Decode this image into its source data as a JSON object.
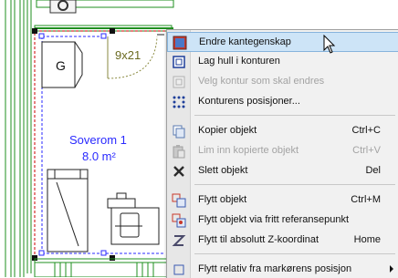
{
  "floorplan": {
    "room_name": "Soverom 1",
    "room_area": "8.0 m²",
    "box_g_label": "G",
    "door_label": "9x21"
  },
  "context_menu": {
    "items": [
      {
        "label": "Endre kantegenskap",
        "shortcut": "",
        "enabled": true,
        "highlighted": true,
        "icon": "edge-properties-icon"
      },
      {
        "label": "Lag hull i konturen",
        "shortcut": "",
        "enabled": true,
        "icon": "make-hole-icon"
      },
      {
        "label": "Velg kontur som skal endres",
        "shortcut": "",
        "enabled": false,
        "icon": "select-contour-icon"
      },
      {
        "label": "Konturens posisjoner...",
        "shortcut": "",
        "enabled": true,
        "icon": "contour-positions-icon"
      },
      {
        "label": "Kopier objekt",
        "shortcut": "Ctrl+C",
        "enabled": true,
        "icon": "copy-icon"
      },
      {
        "label": "Lim inn kopierte objekt",
        "shortcut": "Ctrl+V",
        "enabled": false,
        "icon": "paste-icon"
      },
      {
        "label": "Slett objekt",
        "shortcut": "Del",
        "enabled": true,
        "icon": "delete-icon"
      },
      {
        "label": "Flytt objekt",
        "shortcut": "Ctrl+M",
        "enabled": true,
        "icon": "move-icon"
      },
      {
        "label": "Flytt objekt via fritt referansepunkt",
        "shortcut": "",
        "enabled": true,
        "icon": "move-reference-icon"
      },
      {
        "label": "Flytt til absolutt Z-koordinat",
        "shortcut": "Home",
        "enabled": true,
        "icon": "z-coordinate-icon"
      },
      {
        "label": "Flytt relativ fra markørens posisjon",
        "shortcut": "",
        "enabled": true,
        "icon": "move-relative-icon",
        "submenu": true
      }
    ]
  },
  "colors": {
    "wall_green": "#1f8f1f",
    "selection_red": "#cc0000",
    "room_text_blue": "#2a2aff",
    "menu_bg": "#f1f1f1",
    "menu_highlight": "#cde4f7"
  }
}
